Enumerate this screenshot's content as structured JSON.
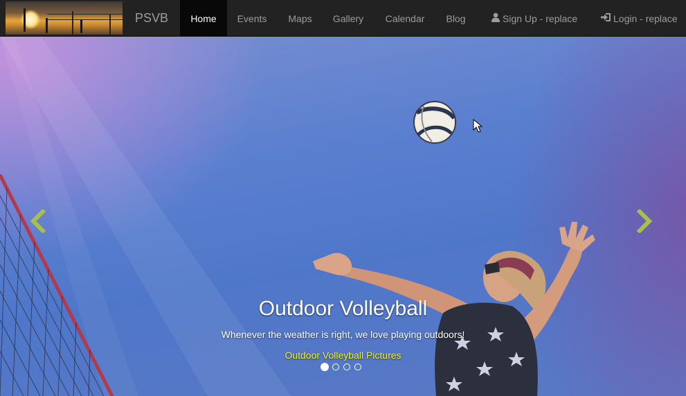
{
  "brand": "PSVB",
  "nav": {
    "items": [
      {
        "label": "Home",
        "active": true
      },
      {
        "label": "Events",
        "active": false
      },
      {
        "label": "Maps",
        "active": false
      },
      {
        "label": "Gallery",
        "active": false
      },
      {
        "label": "Calendar",
        "active": false
      },
      {
        "label": "Blog",
        "active": false
      }
    ],
    "signup": {
      "label": "Sign Up - replace",
      "icon": "user-icon"
    },
    "login": {
      "label": "Login - replace",
      "icon": "log-in-icon"
    }
  },
  "carousel": {
    "title": "Outdoor Volleyball",
    "text": "Whenever the weather is right, we love playing outdoors!",
    "link": "Outdoor Volleyball Pictures",
    "slide_count": 4,
    "active_index": 0,
    "prev_icon": "chevron-left-icon",
    "next_icon": "chevron-right-icon"
  },
  "colors": {
    "navbar": "#222222",
    "active_nav": "#080808",
    "nav_text": "#9d9d9d",
    "link_yellow": "#f1ef22",
    "arrow": "#a8c04a",
    "sky": "#5a7fcf"
  }
}
